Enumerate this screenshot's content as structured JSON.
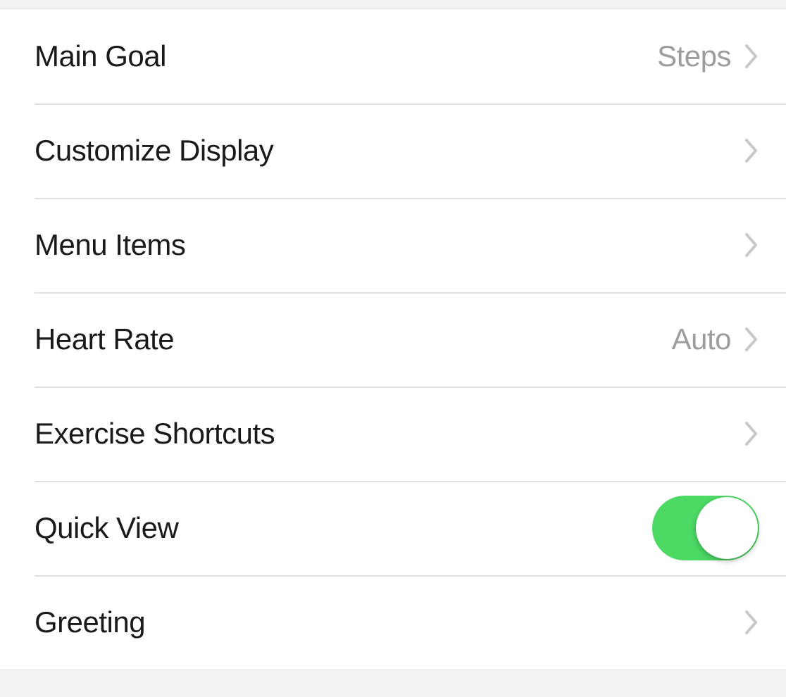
{
  "settings": {
    "rows": [
      {
        "id": "main-goal",
        "label": "Main Goal",
        "value": "Steps",
        "type": "navigate"
      },
      {
        "id": "customize-display",
        "label": "Customize Display",
        "value": "",
        "type": "navigate"
      },
      {
        "id": "menu-items",
        "label": "Menu Items",
        "value": "",
        "type": "navigate"
      },
      {
        "id": "heart-rate",
        "label": "Heart Rate",
        "value": "Auto",
        "type": "navigate"
      },
      {
        "id": "exercise-shortcuts",
        "label": "Exercise Shortcuts",
        "value": "",
        "type": "navigate"
      },
      {
        "id": "quick-view",
        "label": "Quick View",
        "on": true,
        "type": "toggle"
      },
      {
        "id": "greeting",
        "label": "Greeting",
        "value": "",
        "type": "navigate"
      }
    ]
  },
  "colors": {
    "toggle_on": "#4cd964",
    "text_primary": "#1a1a1a",
    "text_secondary": "#9d9d9d",
    "divider": "#e1e1e1",
    "background": "#f2f2f2"
  }
}
